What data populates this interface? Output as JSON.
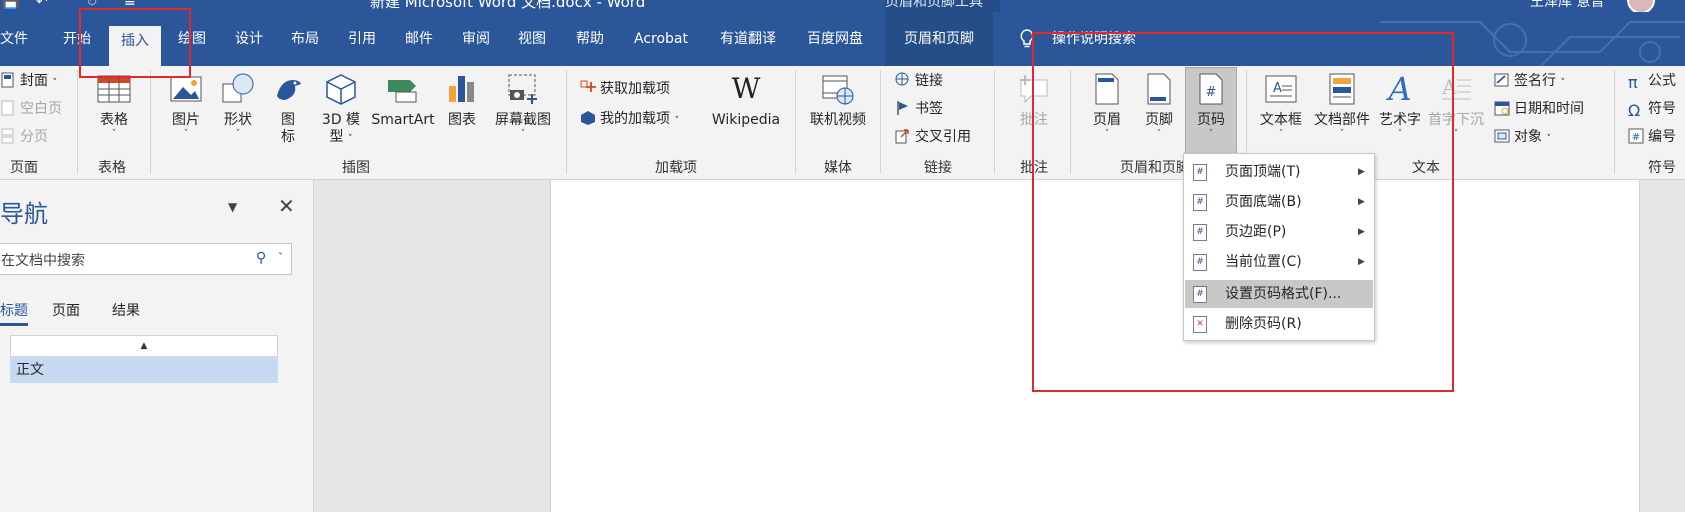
{
  "window": {
    "doc_title": "新建 Microsoft Word 文档.docx - Word",
    "context_title": "页眉和页脚工具",
    "user_name": "王泽库 意晋"
  },
  "tabs": [
    {
      "label": "文件"
    },
    {
      "label": "开始"
    },
    {
      "label": "插入",
      "active": true
    },
    {
      "label": "绘图"
    },
    {
      "label": "设计"
    },
    {
      "label": "布局"
    },
    {
      "label": "引用"
    },
    {
      "label": "邮件"
    },
    {
      "label": "审阅"
    },
    {
      "label": "视图"
    },
    {
      "label": "帮助"
    },
    {
      "label": "Acrobat"
    },
    {
      "label": "有道翻译"
    },
    {
      "label": "百度网盘"
    },
    {
      "label": "页眉和页脚",
      "contextual": true
    }
  ],
  "tell_me": "操作说明搜索",
  "ribbon": {
    "pages_group": {
      "label": "页面",
      "cover": "封面",
      "blank": "空白页",
      "break": "分页"
    },
    "table_group": {
      "label": "表格",
      "table": "表格"
    },
    "illustrations_group": {
      "label": "插图",
      "picture": "图片",
      "shapes": "形状",
      "icons_line1": "图",
      "icons_line2": "标",
      "models_line1": "3D 模",
      "models_line2": "型",
      "smartart": "SmartArt",
      "chart": "图表",
      "screenshot": "屏幕截图"
    },
    "addins_group": {
      "label": "加载项",
      "get": "获取加载项",
      "mine": "我的加载项",
      "wikipedia": "Wikipedia"
    },
    "media_group": {
      "label": "媒体",
      "video": "联机视频"
    },
    "links_group": {
      "label": "链接",
      "link": "链接",
      "bookmark": "书签",
      "crossref": "交叉引用"
    },
    "comments_group": {
      "label": "批注",
      "comment": "批注"
    },
    "header_footer_group": {
      "label": "页眉和页脚",
      "header": "页眉",
      "footer": "页脚",
      "page_number": "页码"
    },
    "text_group": {
      "label": "文本",
      "textbox": "文本框",
      "quickparts": "文档部件",
      "wordart": "艺术字",
      "dropcap": "首字下沉",
      "signature": "签名行",
      "datetime": "日期和时间",
      "object": "对象"
    },
    "symbols_group": {
      "label": "符号",
      "equation": "公式",
      "symbol": "符号",
      "number": "编号"
    }
  },
  "nav_pane": {
    "title": "导航",
    "search_placeholder": "在文档中搜索",
    "tabs": [
      "标题",
      "页面",
      "结果"
    ],
    "heading_item": "正文"
  },
  "page_number_menu": [
    {
      "label": "页面顶端(T)",
      "submenu": true
    },
    {
      "label": "页面底端(B)",
      "submenu": true
    },
    {
      "label": "页边距(P)",
      "submenu": true
    },
    {
      "label": "当前位置(C)",
      "submenu": true
    },
    {
      "label": "设置页码格式(F)...",
      "submenu": false,
      "highlighted": true
    },
    {
      "label": "删除页码(R)",
      "submenu": false
    }
  ],
  "colors": {
    "word_blue": "#2b579a",
    "annotation_red": "#e02a2a",
    "ribbon_bg": "#f3f3f3"
  }
}
